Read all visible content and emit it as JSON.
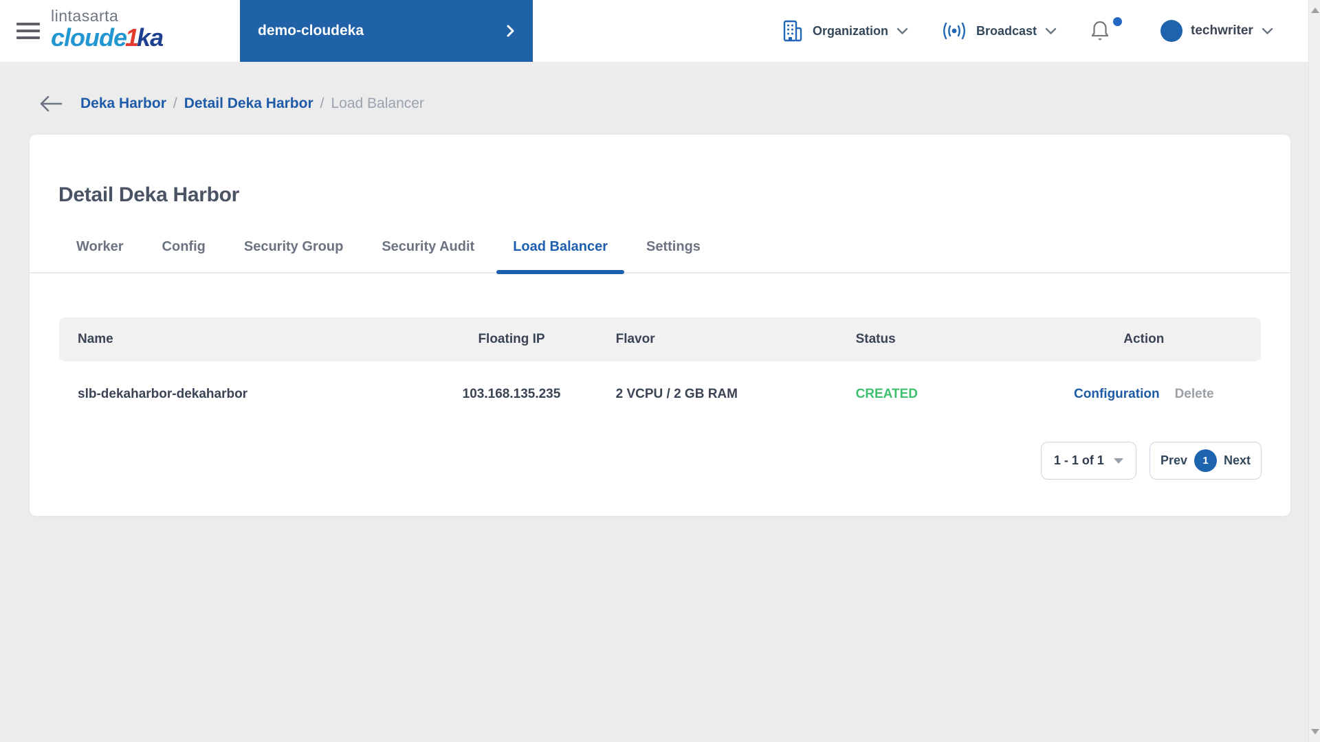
{
  "colors": {
    "accent_blue": "#2062a8",
    "link_blue": "#1d5ba9",
    "active_tab_blue": "#1d5fae",
    "status_green": "#3ec06f",
    "logo_light_blue": "#2196d1",
    "logo_red": "#e23a2e",
    "logo_navy": "#1c3f90",
    "page_background": "#ececec",
    "table_header_bg": "#f1f1f1"
  },
  "header": {
    "logo_top": "lintasarta",
    "logo_part1": "cloude",
    "logo_part2": "1",
    "logo_part3": "ka",
    "project_button": "demo-cloudeka",
    "organization_label": "Organization",
    "broadcast_label": "Broadcast",
    "username": "techwriter"
  },
  "breadcrumb": {
    "separator": "/",
    "items": [
      {
        "label": "Deka Harbor"
      },
      {
        "label": "Detail Deka Harbor"
      },
      {
        "label": "Load Balancer"
      }
    ]
  },
  "page": {
    "title": "Detail Deka Harbor"
  },
  "tabs": {
    "active": "Load Balancer",
    "items": [
      {
        "label": "Worker"
      },
      {
        "label": "Config"
      },
      {
        "label": "Security Group"
      },
      {
        "label": "Security Audit"
      },
      {
        "label": "Load Balancer"
      },
      {
        "label": "Settings"
      }
    ]
  },
  "table": {
    "headers": [
      "Name",
      "Floating IP",
      "Flavor",
      "Status",
      "Action"
    ],
    "rows": [
      {
        "name": "slb-dekaharbor-dekaharbor",
        "floating_ip": "103.168.135.235",
        "flavor": "2 VCPU / 2 GB RAM",
        "status": "CREATED",
        "actions": [
          "Configuration",
          "Delete"
        ]
      }
    ]
  },
  "pagination": {
    "range_label": "1 - 1 of 1",
    "prev": "Prev",
    "page": "1",
    "next": "Next"
  }
}
